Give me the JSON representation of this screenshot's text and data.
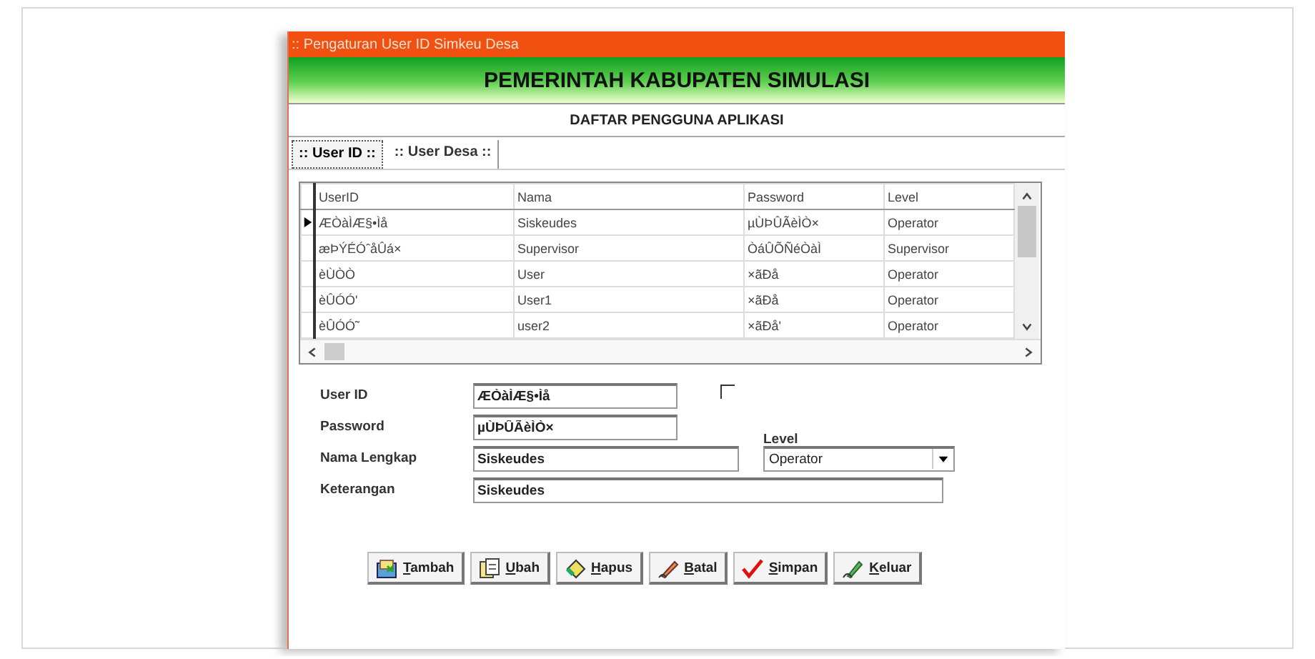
{
  "window": {
    "title": ":: Pengaturan User ID Simkeu Desa"
  },
  "header": {
    "title": "PEMERINTAH KABUPATEN SIMULASI",
    "subtitle": "DAFTAR PENGGUNA APLIKASI"
  },
  "tabs": [
    {
      "label": ":: User ID ::",
      "selected": true
    },
    {
      "label": ":: User Desa ::",
      "selected": false
    }
  ],
  "table": {
    "columns": [
      "UserID",
      "Nama",
      "Password",
      "Level"
    ],
    "rows": [
      {
        "cells": [
          "ÆÒàÌÆ§•Ìå",
          "Siskeudes",
          "µÙÞÛÃèÌÒ×",
          "Operator"
        ],
        "selected": true
      },
      {
        "cells": [
          "æÞÝÉÓˆåÛá×",
          "Supervisor",
          "ÒáÛÕÑéÒàÌ",
          "Supervisor"
        ],
        "selected": false
      },
      {
        "cells": [
          "èÙÒÒ",
          "User",
          "×ãÐå",
          "Operator"
        ],
        "selected": false
      },
      {
        "cells": [
          "èÛÓÓ'",
          "User1",
          "×ãÐå",
          "Operator"
        ],
        "selected": false
      },
      {
        "cells": [
          "èÛÓÓ˜",
          "user2",
          "×ãÐå'",
          "Operator"
        ],
        "selected": false
      }
    ]
  },
  "form": {
    "user_id": {
      "label": "User ID",
      "value": "ÆÒàÌÆ§•Ìå"
    },
    "checkbox": {
      "checked": false
    },
    "password": {
      "label": "Password",
      "value": "µÙÞÛÃèÌÒ×"
    },
    "nama_lengkap": {
      "label": "Nama Lengkap",
      "value": "Siskeudes"
    },
    "level": {
      "label": "Level",
      "value": "Operator"
    },
    "keterangan": {
      "label": "Keterangan",
      "value": "Siskeudes"
    }
  },
  "buttons": [
    {
      "label": "Tambah",
      "kind": "add"
    },
    {
      "label": "Ubah",
      "kind": "edit"
    },
    {
      "label": "Hapus",
      "kind": "delete"
    },
    {
      "label": "Batal",
      "kind": "cancel"
    },
    {
      "label": "Simpan",
      "kind": "save"
    },
    {
      "label": "Keluar",
      "kind": "exit"
    }
  ]
}
